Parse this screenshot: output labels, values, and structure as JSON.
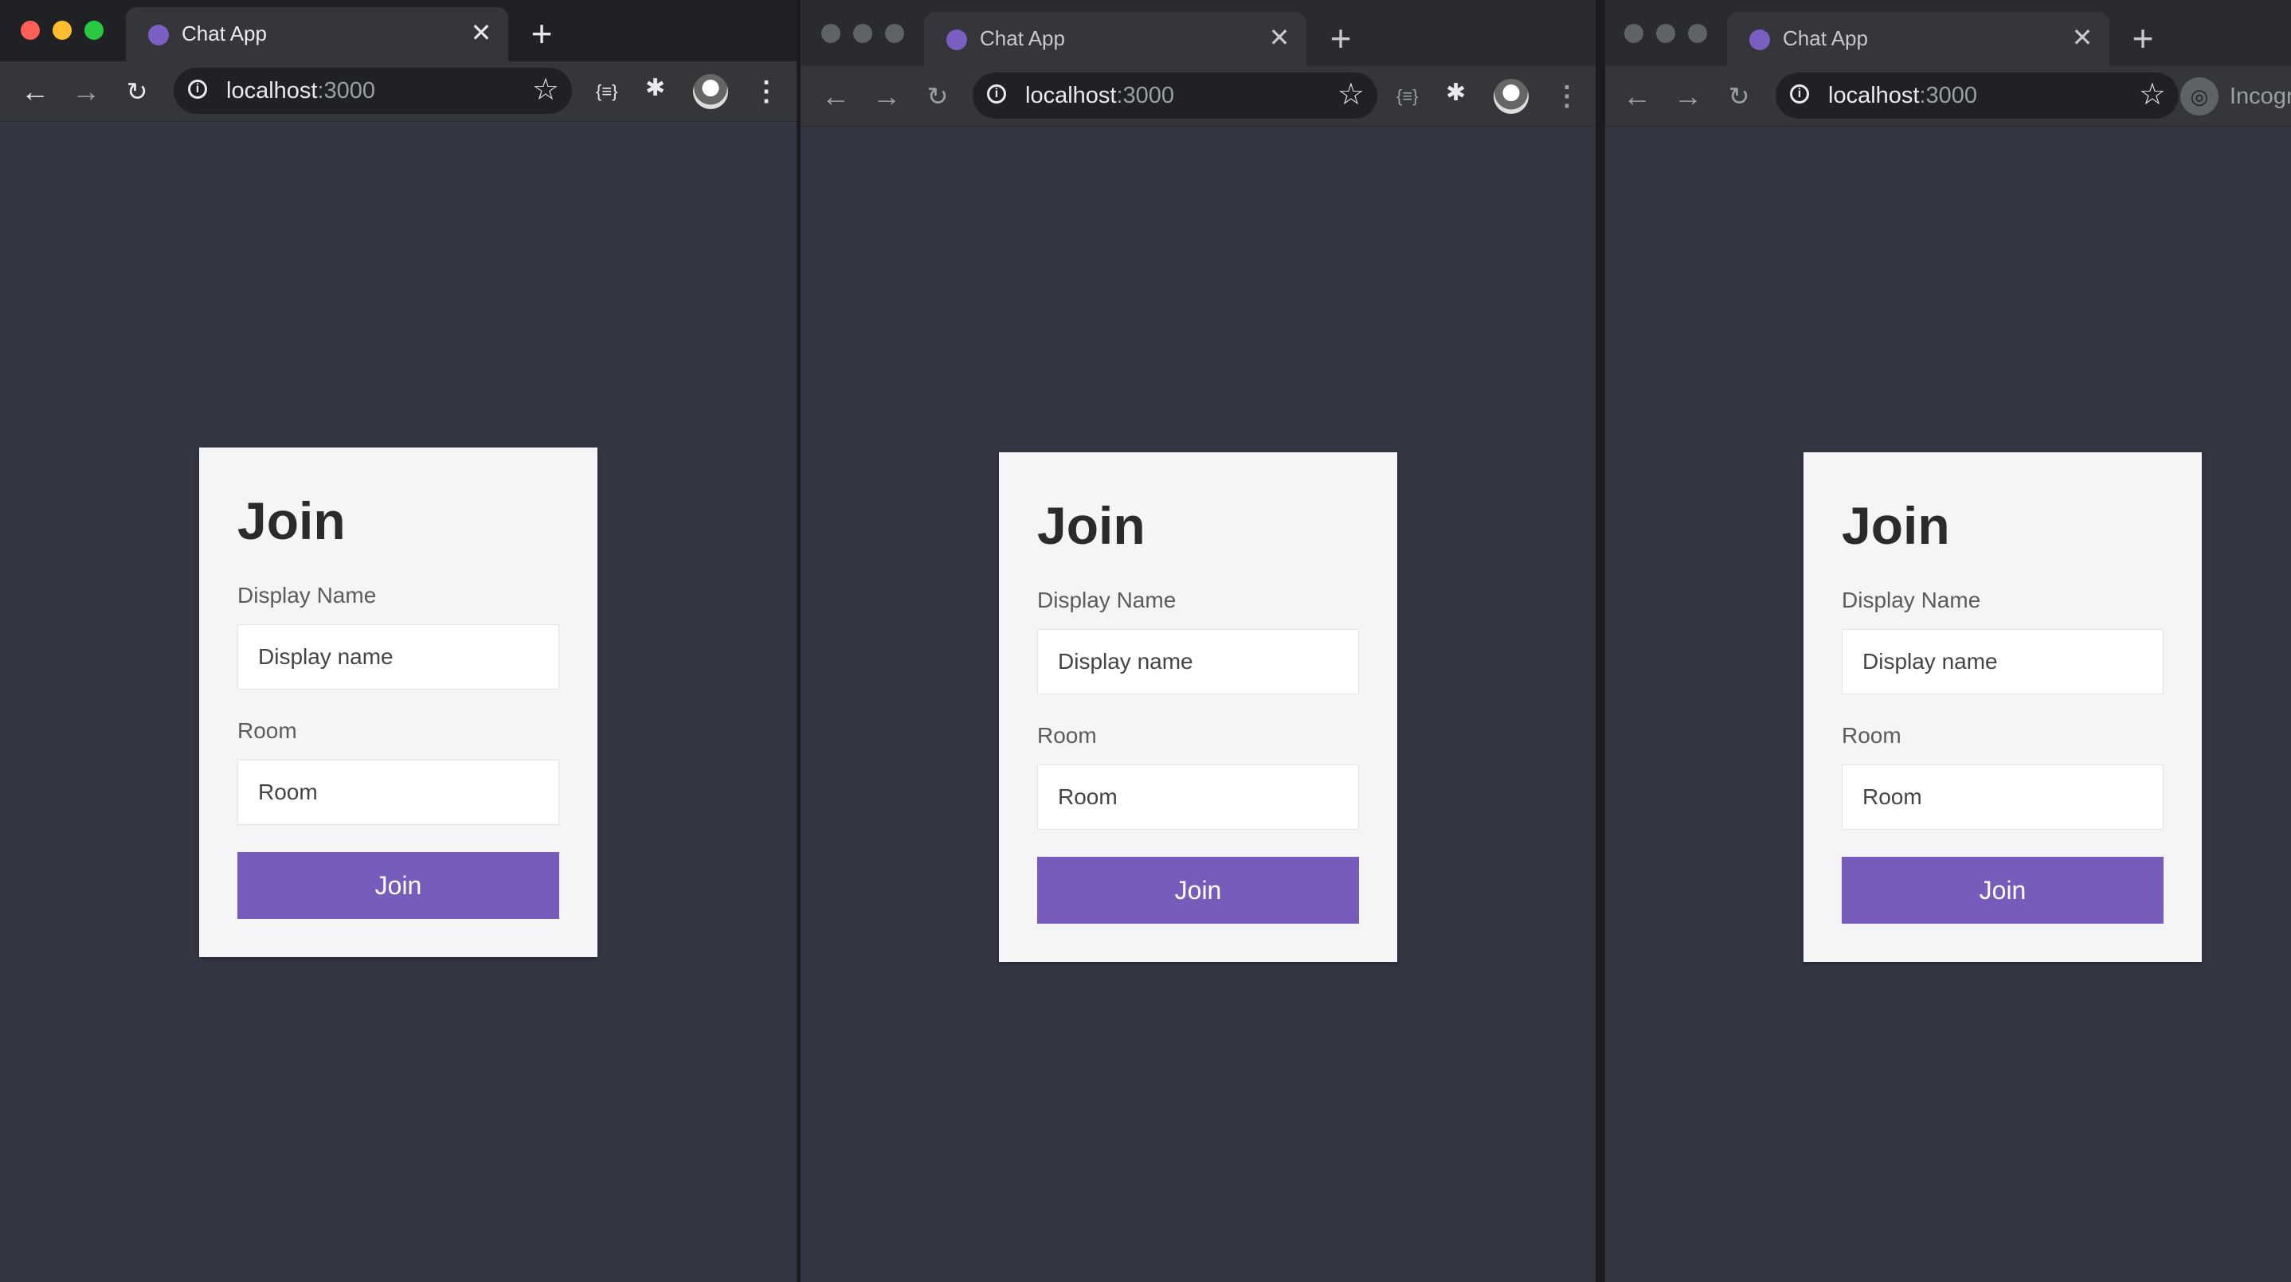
{
  "colors": {
    "accent": "#775cbb",
    "page_background": "#343644",
    "tab_favicon": "#7b5ec1",
    "traffic_close": "#fe5f57",
    "traffic_minimize": "#febc2e",
    "traffic_maximize": "#28c840"
  },
  "windows": [
    {
      "tab": {
        "title": "Chat App"
      },
      "address": {
        "host": "localhost",
        "port": ":3000"
      },
      "form": {
        "heading": "Join",
        "display_name_label": "Display Name",
        "display_name_placeholder": "Display name",
        "room_label": "Room",
        "room_placeholder": "Room",
        "submit_label": "Join"
      }
    },
    {
      "tab": {
        "title": "Chat App"
      },
      "address": {
        "host": "localhost",
        "port": ":3000"
      },
      "form": {
        "heading": "Join",
        "display_name_label": "Display Name",
        "display_name_placeholder": "Display name",
        "room_label": "Room",
        "room_placeholder": "Room",
        "submit_label": "Join"
      }
    },
    {
      "tab": {
        "title": "Chat App"
      },
      "address": {
        "host": "localhost",
        "port": ":3000"
      },
      "incognito_label": "Incogn",
      "form": {
        "heading": "Join",
        "display_name_label": "Display Name",
        "display_name_placeholder": "Display name",
        "room_label": "Room",
        "room_placeholder": "Room",
        "submit_label": "Join"
      }
    }
  ],
  "icons": {
    "back": "arrow-left-icon",
    "forward": "arrow-right-icon",
    "reload": "reload-icon",
    "site_info": "info-icon",
    "bookmark": "star-icon",
    "extension_code": "code-braces-icon",
    "extensions": "puzzle-icon",
    "profile": "avatar-icon",
    "menu": "kebab-menu-icon",
    "new_tab": "plus-icon",
    "close_tab": "close-icon",
    "incognito": "incognito-icon"
  }
}
